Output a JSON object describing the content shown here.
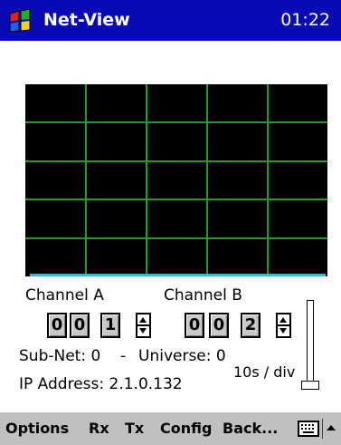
{
  "titlebar": {
    "title": "Net-View",
    "time": "01:22"
  },
  "channel_a": {
    "label": "Channel A",
    "digits": [
      "0",
      "0",
      "1"
    ]
  },
  "channel_b": {
    "label": "Channel B",
    "digits": [
      "0",
      "0",
      "2"
    ]
  },
  "info": {
    "subnet": "Sub-Net: 0",
    "separator": "-",
    "universe": "Universe: 0",
    "ip": "IP Address: 2.1.0.132",
    "timebase": "10s / div"
  },
  "menu": {
    "items": [
      "Options",
      "Rx",
      "Tx",
      "Config",
      "Back..."
    ],
    "icons": [
      "keyboard-icon",
      "chevron-up-icon"
    ]
  },
  "colors": {
    "titlebar": "#0a0ab4",
    "scope_bg": "#000000",
    "grid": "#1aa01a",
    "trace": "#38b8d8",
    "menubar": "#c0c0c0"
  }
}
